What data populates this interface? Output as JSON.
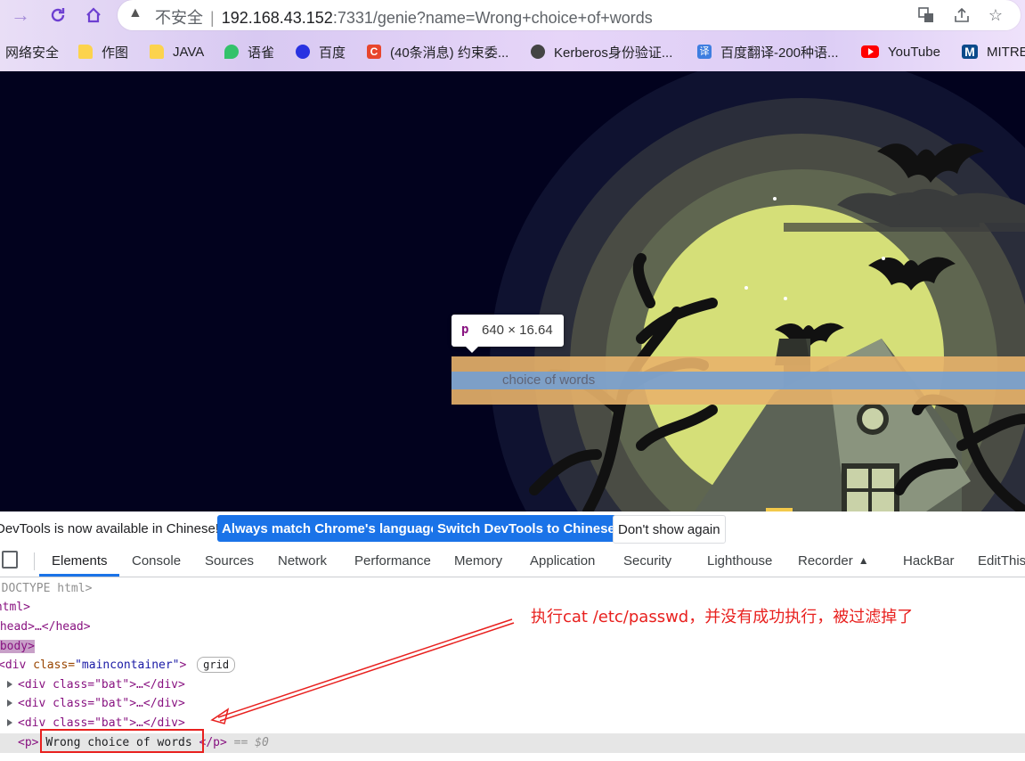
{
  "browser": {
    "security_label": "不安全",
    "url_host": "192.168.43.152",
    "url_rest": ":7331/genie?name=Wrong+choice+of+words",
    "bookmarks": [
      {
        "label": "网络安全",
        "icon": "none"
      },
      {
        "label": "作图",
        "icon": "folder-icon"
      },
      {
        "label": "JAVA",
        "icon": "folder-icon"
      },
      {
        "label": "语雀",
        "icon": "yuque-icon"
      },
      {
        "label": "百度",
        "icon": "baidu-icon"
      },
      {
        "label": "(40条消息) 约束委...",
        "icon": "csdn-icon"
      },
      {
        "label": "Kerberos身份验证...",
        "icon": "github-icon"
      },
      {
        "label": "百度翻译-200种语...",
        "icon": "translate-icon"
      },
      {
        "label": "YouTube",
        "icon": "youtube-icon"
      },
      {
        "label": "MITRE",
        "icon": "mitre-icon"
      }
    ]
  },
  "page": {
    "tooltip_tag": "p",
    "tooltip_size": "640 × 16.64",
    "visible_text": "choice of words"
  },
  "langbar": {
    "message": "DevTools is now available in Chinese!",
    "btn_match": "Always match Chrome's language",
    "btn_switch": "Switch DevTools to Chinese",
    "btn_dismiss": "Don't show again"
  },
  "devtools": {
    "tabs": [
      "Elements",
      "Console",
      "Sources",
      "Network",
      "Performance",
      "Memory",
      "Application",
      "Security",
      "Lighthouse",
      "Recorder",
      "HackBar",
      "EditThisC"
    ],
    "dom": {
      "doctype": "<!DOCTYPE html>",
      "html_open": "<html>",
      "head": "<head>…</head>",
      "body": "<body>",
      "div_open": "<div",
      "div_class_attr": "class=",
      "div_class_val": "\"maincontainer\"",
      "div_close_bracket": ">",
      "grid_badge": "grid",
      "bat_line": "<div class=\"bat\">…</div>",
      "p_open": "<p>",
      "p_text": "Wrong choice of words",
      "p_close": "</p>",
      "p_suffix": "== $0"
    }
  },
  "annotation": {
    "text": "执行cat /etc/passwd，并没有成功执行，被过滤掉了",
    "color": "#e8201e"
  }
}
